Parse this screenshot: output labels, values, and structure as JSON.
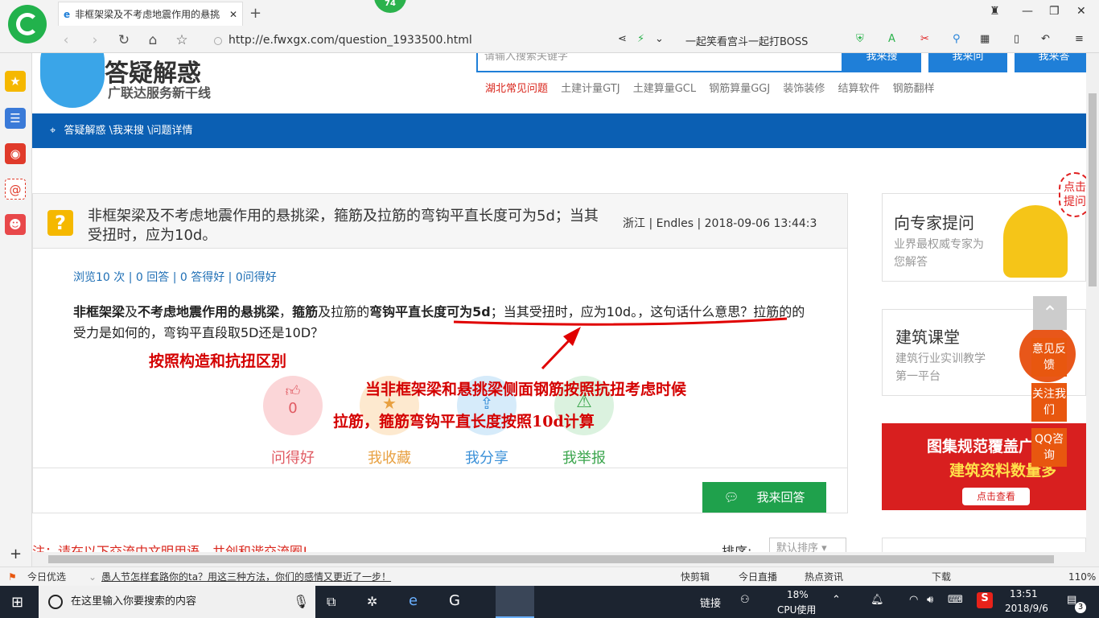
{
  "browser": {
    "tab_title": "非框架梁及不考虑地震作用的悬挑",
    "badge": "74",
    "url": "http://e.fwxgx.com/question_1933500.html",
    "promo_text": "一起笑看宫斗一起打BOSS",
    "zoom": "110%"
  },
  "site": {
    "logo_title": "答疑解惑",
    "logo_subtitle": "广联达服务新干线",
    "search_placeholder": "请输入搜索关键字",
    "buttons": [
      "我来搜",
      "我来问",
      "我来答"
    ],
    "nav_links": [
      "湖北常见问题",
      "土建计量GTJ",
      "土建算量GCL",
      "钢筋算量GGJ",
      "装饰装修",
      "结算软件",
      "钢筋翻样"
    ],
    "breadcrumb": "答疑解惑 \\我来搜 \\问题详情"
  },
  "question": {
    "title": "非框架梁及不考虑地震作用的悬挑梁，箍筋及拉筋的弯钩平直长度可为5d；当其受扭时，应为10d。",
    "meta": "浙江 | Endles | 2018-09-06 13:44:3",
    "stats": "浏览10 次 | 0 回答 | 0 答得好 | 0问得好",
    "body_parts": [
      "非框架梁",
      "及",
      "不考虑地震作用的悬挑梁",
      "，",
      "箍筋",
      "及拉筋的",
      "弯钩平直长度可为5d",
      "；当其受扭时，应为10d。，这句话什么意思？拉筋的的受力是如何的，弯钩平直段取5D还是10D？"
    ],
    "like_count": "0",
    "actions": [
      "问得好",
      "我收藏",
      "我分享",
      "我举报"
    ],
    "answer_button": "我来回答",
    "notice": "注：请在以下交流中文明用语，共创和谐交流圈!",
    "sort_label": "排序:",
    "sort_value": "默认排序"
  },
  "annotations": {
    "note1": "按照构造和抗扭区别",
    "note2": "当非框架梁和悬挑梁侧面钢筋按照抗扭考虑时候",
    "note3": "拉筋，箍筋弯钩平直长度按照10d计算"
  },
  "sidebar_right": {
    "expert_title": "向专家提问",
    "expert_sub": "业界最权威专家为您解答",
    "course_title": "建筑课堂",
    "course_sub": "建筑行业实训教学第一平台",
    "banner_line1": "图集规范覆盖广",
    "banner_line2": "建筑资料数量多",
    "banner_btn": "点击查看",
    "float_buttons": [
      "意见反馈",
      "关注我们",
      "QQ咨询"
    ],
    "bubble": "点击提问"
  },
  "statusbar": {
    "left": "今日优选",
    "news": "愚人节怎样套路你的ta？用这三种方法，你们的感情又更近了一步！",
    "items": [
      "快剪辑",
      "今日直播",
      "热点资讯",
      "下载"
    ],
    "zoom": "110%"
  },
  "taskbar": {
    "search_placeholder": "在这里输入你要搜索的内容",
    "link_label": "链接",
    "cpu_percent": "18%",
    "cpu_label": "CPU使用",
    "time": "13:51",
    "date": "2018/9/6",
    "notif_count": "3"
  }
}
